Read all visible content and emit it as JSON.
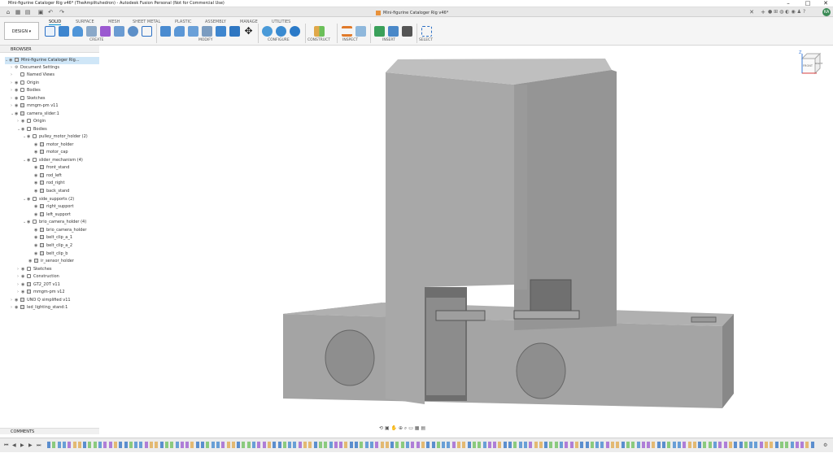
{
  "window": {
    "title": "Mini-figurine Cataloger Rig v46* (TheAmplituhedron) - Autodesk Fusion Personal (Not for Commercial Use)",
    "controls": [
      "–",
      "□",
      "✕"
    ]
  },
  "document_tab": {
    "label": "Mini-figurine Cataloger Rig v46*"
  },
  "user": {
    "initials": "KA"
  },
  "colors": {
    "accent": "#0696d7",
    "sketch": "#2b6fc4",
    "body": "#3e86cf",
    "component": "#e0a84a",
    "selection": "#cfe6f7"
  },
  "ribbon": {
    "workspace": "DESIGN",
    "tabs": [
      "SOLID",
      "SURFACE",
      "MESH",
      "SHEET METAL",
      "PLASTIC",
      "ASSEMBLY",
      "MANAGE",
      "UTILITIES"
    ],
    "active_tab": "SOLID",
    "groups": [
      "CREATE",
      "MODIFY",
      "CONFIGURE",
      "CONSTRUCT",
      "INSPECT",
      "INSERT",
      "SELECT"
    ]
  },
  "browser": {
    "title": "BROWSER",
    "nodes": [
      {
        "label": "Mini-figurine Cataloger Rig..."
      },
      {
        "label": "Document Settings"
      },
      {
        "label": "Named Views"
      },
      {
        "label": "Origin"
      },
      {
        "label": "Bodies"
      },
      {
        "label": "Sketches"
      },
      {
        "label": "mmgm-pm v11"
      },
      {
        "label": "camera_slider:1"
      },
      {
        "label": "Origin"
      },
      {
        "label": "Bodies"
      },
      {
        "label": "pulley_motor_holder (2)"
      },
      {
        "label": "motor_holder"
      },
      {
        "label": "motor_cap"
      },
      {
        "label": "slider_mechanism (4)"
      },
      {
        "label": "front_stand"
      },
      {
        "label": "rod_left"
      },
      {
        "label": "rod_right"
      },
      {
        "label": "back_stand"
      },
      {
        "label": "side_supports (2)"
      },
      {
        "label": "right_support"
      },
      {
        "label": "left_support"
      },
      {
        "label": "brio_camera_holder (4)"
      },
      {
        "label": "brio_camera_holder"
      },
      {
        "label": "belt_clip_a_1"
      },
      {
        "label": "belt_clip_a_2"
      },
      {
        "label": "belt_clip_b"
      },
      {
        "label": "ir_sensor_holder"
      },
      {
        "label": "Sketches"
      },
      {
        "label": "Construction"
      },
      {
        "label": "GT2_20T v11"
      },
      {
        "label": "mmgm-pm v12"
      },
      {
        "label": "UNO Q simplified v11"
      },
      {
        "label": "led_lighting_stand:1"
      }
    ]
  },
  "comments": {
    "label": "COMMENTS"
  },
  "viewcube": {
    "top": "Z",
    "front": "FRONT",
    "right": "RIGHT"
  },
  "timeline": {
    "controls": [
      "⏮",
      "◀",
      "▶",
      "▶",
      "⏭"
    ]
  }
}
